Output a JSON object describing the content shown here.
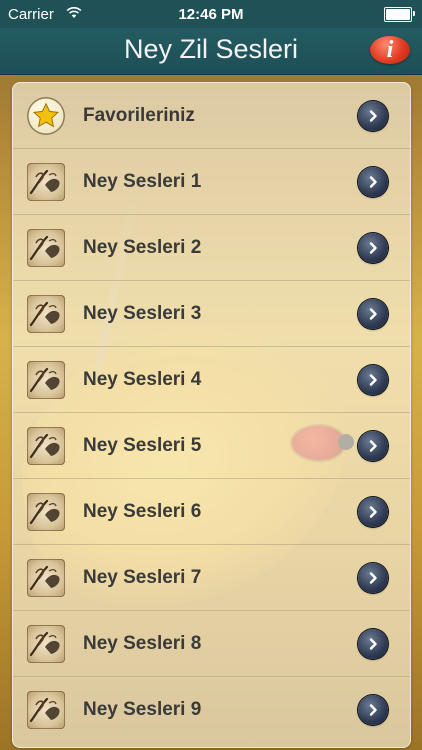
{
  "status_bar": {
    "carrier": "Carrier",
    "time": "12:46 PM"
  },
  "nav": {
    "title": "Ney Zil Sesleri",
    "info_label": "i"
  },
  "list": {
    "items": [
      {
        "label": "Favorileriniz",
        "icon": "star-icon"
      },
      {
        "label": "Ney Sesleri 1",
        "icon": "ney-player-icon"
      },
      {
        "label": "Ney Sesleri 2",
        "icon": "ney-player-icon"
      },
      {
        "label": "Ney Sesleri 3",
        "icon": "ney-player-icon"
      },
      {
        "label": "Ney Sesleri 4",
        "icon": "ney-player-icon"
      },
      {
        "label": "Ney Sesleri 5",
        "icon": "ney-player-icon"
      },
      {
        "label": "Ney Sesleri 6",
        "icon": "ney-player-icon"
      },
      {
        "label": "Ney Sesleri 7",
        "icon": "ney-player-icon"
      },
      {
        "label": "Ney Sesleri 8",
        "icon": "ney-player-icon"
      },
      {
        "label": "Ney Sesleri 9",
        "icon": "ney-player-icon"
      }
    ]
  },
  "colors": {
    "nav_background": "#1f5157",
    "info_button": "#e13c22",
    "chevron_button": "#2e3a52",
    "label_text": "#3a3a3a"
  }
}
